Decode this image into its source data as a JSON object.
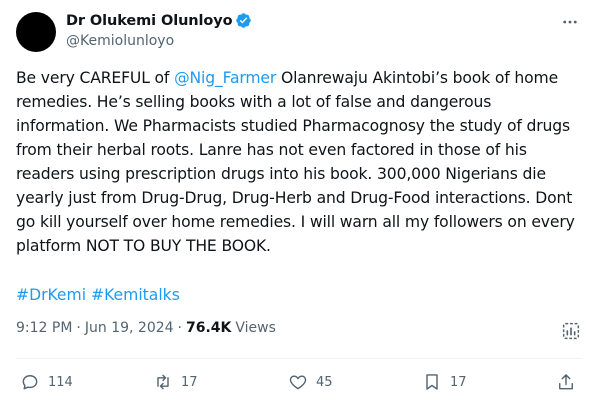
{
  "author": {
    "display_name": "Dr Olukemi Olunloyo",
    "handle": "@Kemiolunloyo"
  },
  "tweet": {
    "text_before_mention": "Be very CAREFUL of ",
    "mention": "@Nig_Farmer",
    "text_after_mention": " Olanrewaju Akintobi’s book of home remedies. He’s selling books with a lot of false and dangerous information. We Pharmacists studied Pharmacognosy the study of drugs from their herbal roots. Lanre has not even factored in those of his readers using prescription drugs into his book. 300,000 Nigerians die yearly just from Drug-Drug, Drug-Herb and Drug-Food interactions. Dont go kill yourself over home remedies. I will warn all my followers on every platform NOT TO BUY THE BOOK.",
    "hashtags": [
      "#DrKemi",
      "#Kemitalks"
    ]
  },
  "meta": {
    "time": "9:12 PM",
    "date": "Jun 19, 2024",
    "views_count": "76.4K",
    "views_label": "Views"
  },
  "actions": {
    "replies": "114",
    "reposts": "17",
    "likes": "45",
    "bookmarks": "17"
  },
  "icons": {
    "verified": "verified-badge-icon",
    "more": "more-icon",
    "analytics": "analytics-icon",
    "reply": "reply-icon",
    "repost": "repost-icon",
    "like": "like-icon",
    "bookmark": "bookmark-icon",
    "share": "share-icon"
  },
  "colors": {
    "accent": "#1d9bf0",
    "muted": "#536471",
    "text": "#0f1419"
  }
}
